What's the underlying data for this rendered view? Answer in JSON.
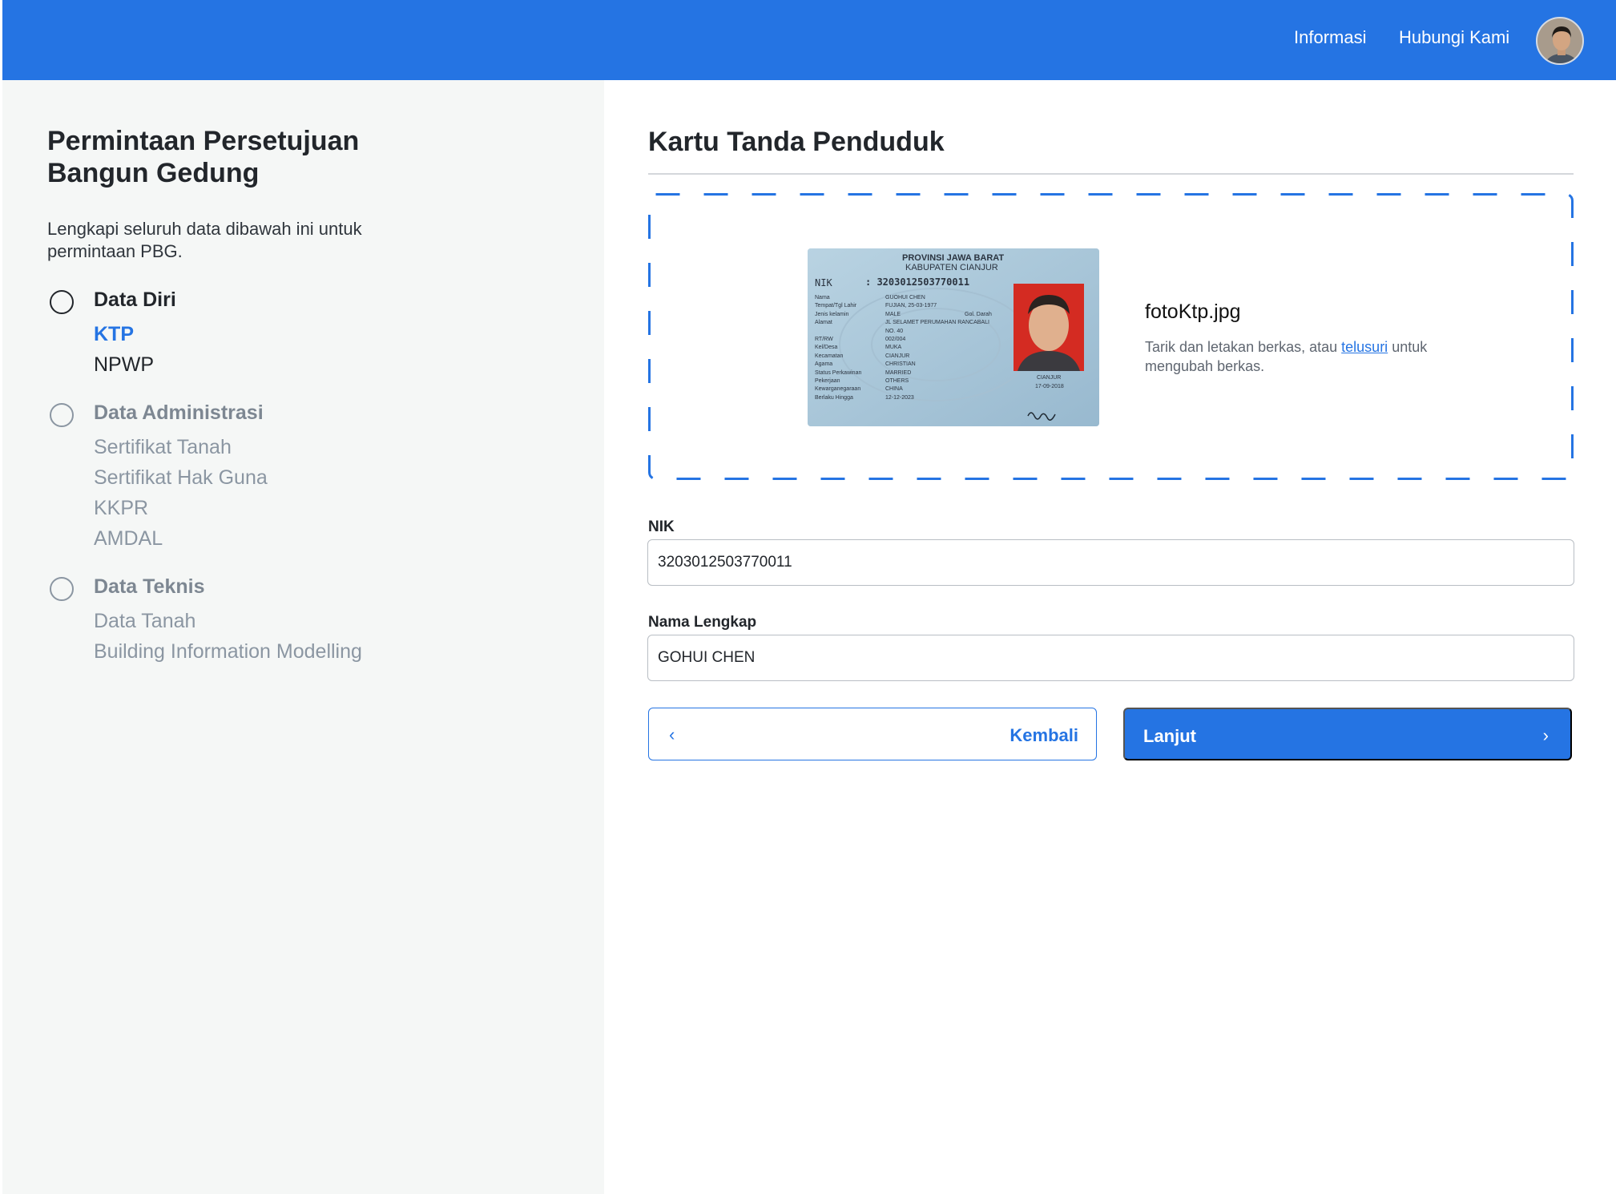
{
  "header": {
    "nav": [
      {
        "label": "Informasi"
      },
      {
        "label": "Hubungi Kami"
      }
    ],
    "avatar_icon": "user-avatar"
  },
  "sidebar": {
    "title": "Permintaan Persetujuan Bangun Gedung",
    "description": "Lengkapi seluruh data dibawah ini untuk permintaan PBG.",
    "steps": [
      {
        "label": "Data Diri",
        "items": [
          "KTP",
          "NPWP"
        ],
        "active_item": "KTP"
      },
      {
        "label": "Data Administrasi",
        "items": [
          "Sertifikat Tanah",
          "Sertifikat Hak Guna",
          "KKPR",
          "AMDAL"
        ]
      },
      {
        "label": "Data Teknis",
        "items": [
          "Data Tanah",
          "Building Information Modelling"
        ]
      }
    ]
  },
  "main": {
    "title": "Kartu Tanda Penduduk",
    "upload": {
      "file_name": "fotoKtp.jpg",
      "hint_prefix": "Tarik dan letakan berkas, atau ",
      "hint_link": "telusuri",
      "hint_suffix": " untuk mengubah berkas."
    },
    "ktp_card": {
      "province": "PROVINSI JAWA BARAT",
      "regency": "KABUPATEN CIANJUR",
      "nik_label": "NIK",
      "nik_value": ": 3203012503770011",
      "rows": [
        {
          "label": "Nama",
          "value": "GUOHUI CHEN"
        },
        {
          "label": "Tempat/Tgl Lahir",
          "value": "FUJIAN, 25-03-1977"
        },
        {
          "label": "Jenis kelamin",
          "value": "MALE"
        },
        {
          "label": "Alamat",
          "value": "JL SELAMET PERUMAHAN RANCABALI"
        },
        {
          "label": "",
          "value": "NO. 40"
        },
        {
          "label": "RT/RW",
          "value": "002/004"
        },
        {
          "label": "Kel/Desa",
          "value": "MUKA"
        },
        {
          "label": "Kecamatan",
          "value": "CIANJUR"
        },
        {
          "label": "Agama",
          "value": "CHRISTIAN"
        },
        {
          "label": "Status Perkawinan",
          "value": "MARRIED"
        },
        {
          "label": "Pekerjaan",
          "value": "OTHERS"
        },
        {
          "label": "Kewarganegaraan",
          "value": "CHINA"
        },
        {
          "label": "Berlaku Hingga",
          "value": "12-12-2023"
        }
      ],
      "blood_type": "Gol. Darah",
      "issue_place": "CIANJUR",
      "issue_date": "17-09-2018"
    },
    "fields": [
      {
        "label": "NIK",
        "value": "3203012503770011"
      },
      {
        "label": "Nama Lengkap",
        "value": "GOHUI CHEN"
      }
    ],
    "buttons": {
      "back": "Kembali",
      "next": "Lanjut"
    },
    "colors": {
      "primary": "#2574e3",
      "sidebar_bg": "#f5f7f6"
    }
  }
}
